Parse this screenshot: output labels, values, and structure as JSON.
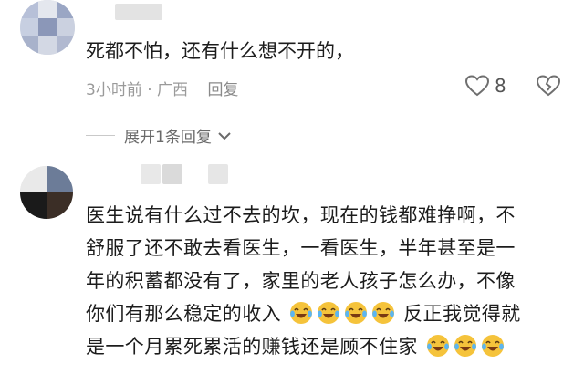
{
  "comments": [
    {
      "text": "死都不怕，还有什么想不开的，",
      "meta": "3小时前 · 广西",
      "reply_label": "回复",
      "like_count": "8",
      "expand_label": "展开1条回复"
    },
    {
      "line1": "医生说有什么过不去的坎，现在的钱都难挣啊，不",
      "line2": "舒服了还不敢去看医生，一看医生，半年甚至是一",
      "line3": "年的积蓄都没有了，家里的老人孩子怎么办，不像",
      "line4": "你们有那么稳定的收入",
      "line4b": "反正我觉得就",
      "line5": "是一个月累死累活的赚钱还是顾不住家"
    }
  ],
  "icons": {
    "like": "heart-icon",
    "dislike": "broken-heart-icon",
    "expand": "chevron-down-icon",
    "emoji": "laughing-crying-face-icon"
  },
  "colors": {
    "text": "#1c1c1c",
    "meta": "#9a9a9a",
    "emoji_face": "#f5c33b"
  }
}
